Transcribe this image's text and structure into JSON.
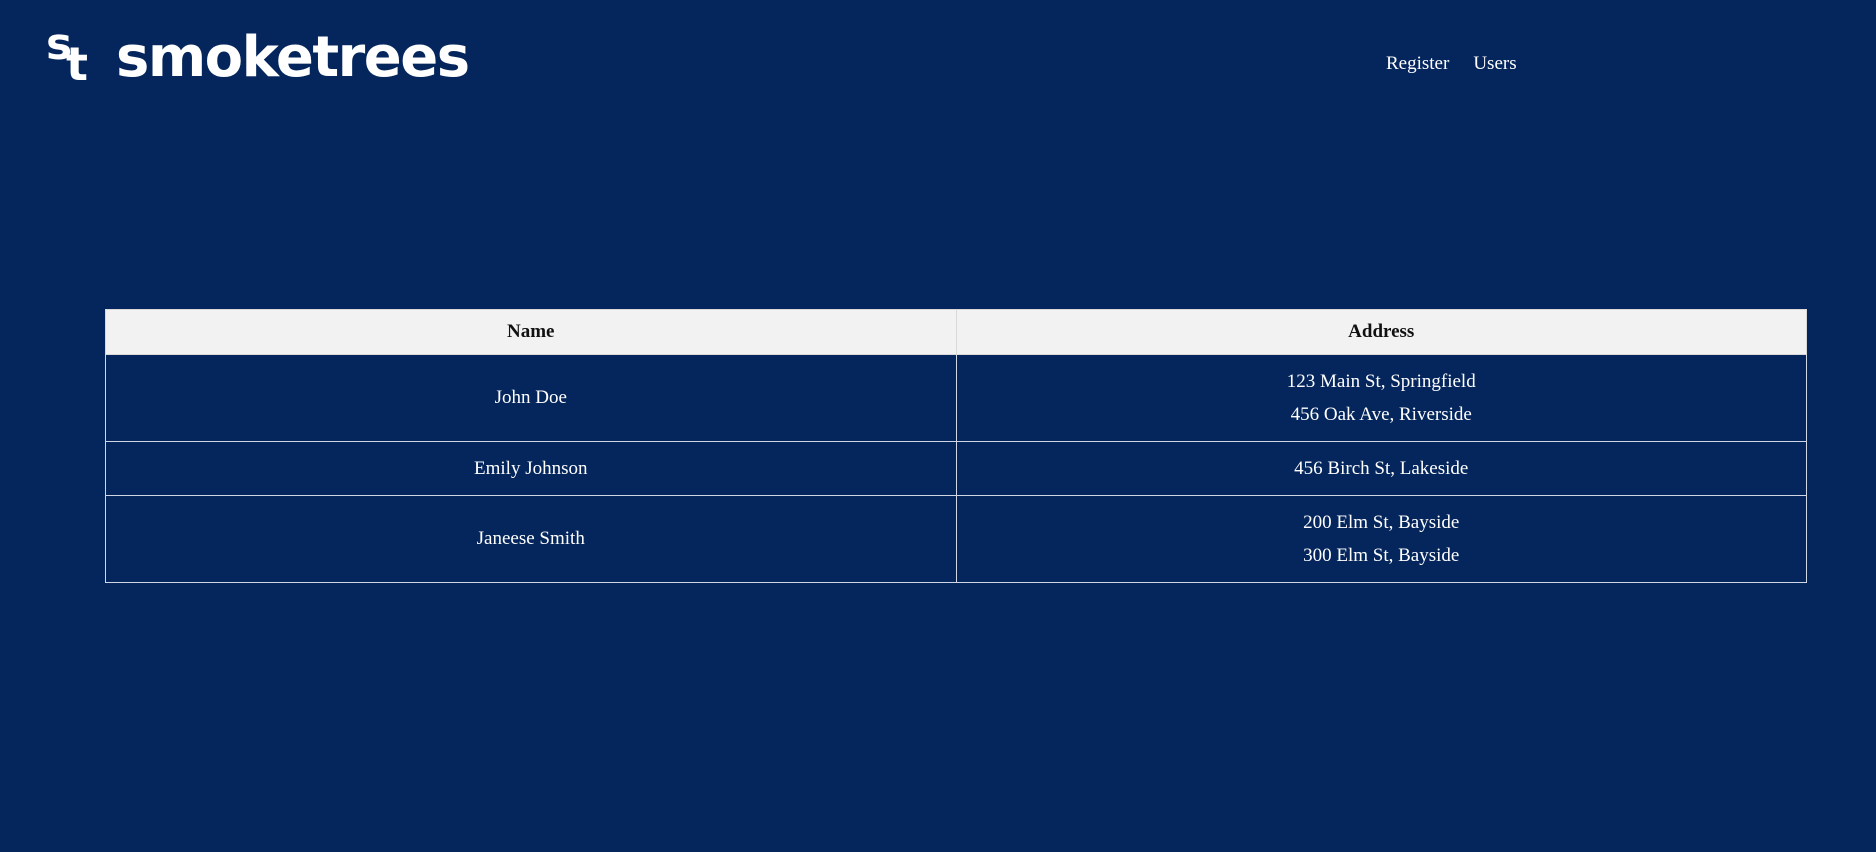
{
  "brand": {
    "mark_s": "s",
    "mark_t": "t",
    "name": "smoketrees"
  },
  "nav": {
    "items": [
      "Register",
      "Users"
    ]
  },
  "table": {
    "headers": [
      "Name",
      "Address"
    ],
    "rows": [
      {
        "name": "John Doe",
        "addresses": [
          "123 Main St, Springfield",
          "456 Oak Ave, Riverside"
        ]
      },
      {
        "name": "Emily Johnson",
        "addresses": [
          "456 Birch St, Lakeside"
        ]
      },
      {
        "name": "Janeese Smith",
        "addresses": [
          "200 Elm St, Bayside",
          "300 Elm St, Bayside"
        ]
      }
    ]
  },
  "colors": {
    "background": "#05265c",
    "header_row": "#f2f2f2",
    "text": "#ffffff"
  }
}
